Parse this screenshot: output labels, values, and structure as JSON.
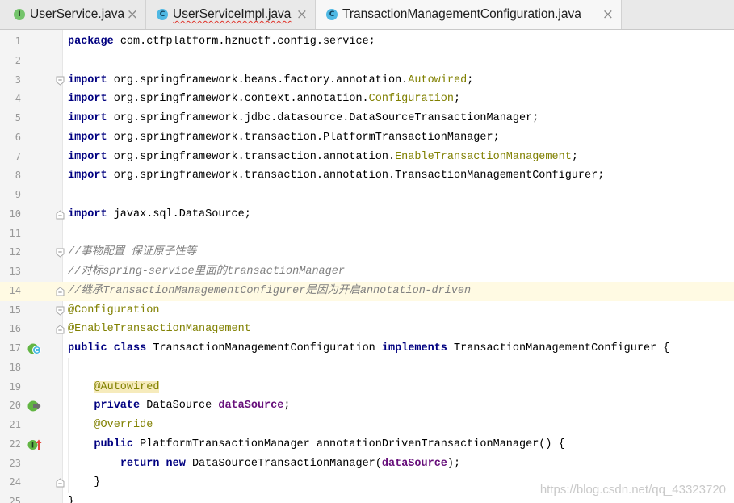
{
  "tabs": [
    {
      "label": "UserService.java",
      "icon": "interface-icon",
      "icon_letter": "I",
      "active": false,
      "has_error": false
    },
    {
      "label": "UserServiceImpl.java",
      "icon": "class-icon",
      "icon_letter": "C",
      "active": false,
      "has_error": true
    },
    {
      "label": "TransactionManagementConfiguration.java",
      "icon": "class-icon",
      "icon_letter": "C",
      "active": true,
      "has_error": false
    }
  ],
  "close_glyph": "×",
  "syntax_colors": {
    "default": "#000000",
    "keyword": "#000080",
    "annotation": "#808000",
    "comment": "#808080",
    "field": "#660e7a",
    "line_number": "#999999",
    "current_line_bg": "#fffae3",
    "warning_bg": "#f6ebbc"
  },
  "editor": {
    "current_line": 14,
    "lines": [
      {
        "n": "1",
        "tokens": [
          {
            "kind": "keyword",
            "text": "package"
          },
          {
            "kind": "plain",
            "text": " com.ctfplatform.hznuctf.config.service;"
          }
        ]
      },
      {
        "n": "2",
        "tokens": []
      },
      {
        "n": "3",
        "fold": "start",
        "tokens": [
          {
            "kind": "keyword",
            "text": "import"
          },
          {
            "kind": "plain",
            "text": " org.springframework.beans.factory.annotation."
          },
          {
            "kind": "annotation",
            "text": "Autowired"
          },
          {
            "kind": "plain",
            "text": ";"
          }
        ]
      },
      {
        "n": "4",
        "tokens": [
          {
            "kind": "keyword",
            "text": "import"
          },
          {
            "kind": "plain",
            "text": " org.springframework.context.annotation."
          },
          {
            "kind": "annotation",
            "text": "Configuration"
          },
          {
            "kind": "plain",
            "text": ";"
          }
        ]
      },
      {
        "n": "5",
        "tokens": [
          {
            "kind": "keyword",
            "text": "import"
          },
          {
            "kind": "plain",
            "text": " org.springframework.jdbc.datasource.DataSourceTransactionManager;"
          }
        ]
      },
      {
        "n": "6",
        "tokens": [
          {
            "kind": "keyword",
            "text": "import"
          },
          {
            "kind": "plain",
            "text": " org.springframework.transaction.PlatformTransactionManager;"
          }
        ]
      },
      {
        "n": "7",
        "tokens": [
          {
            "kind": "keyword",
            "text": "import"
          },
          {
            "kind": "plain",
            "text": " org.springframework.transaction.annotation."
          },
          {
            "kind": "annotation",
            "text": "EnableTransactionManagement"
          },
          {
            "kind": "plain",
            "text": ";"
          }
        ]
      },
      {
        "n": "8",
        "tokens": [
          {
            "kind": "keyword",
            "text": "import"
          },
          {
            "kind": "plain",
            "text": " org.springframework.transaction.annotation.TransactionManagementConfigurer;"
          }
        ]
      },
      {
        "n": "9",
        "tokens": []
      },
      {
        "n": "10",
        "fold": "end",
        "tokens": [
          {
            "kind": "keyword",
            "text": "import"
          },
          {
            "kind": "plain",
            "text": " javax.sql.DataSource;"
          }
        ]
      },
      {
        "n": "11",
        "tokens": []
      },
      {
        "n": "12",
        "fold": "start",
        "tokens": [
          {
            "kind": "comment",
            "text": "//事物配置 保证原子性等"
          }
        ]
      },
      {
        "n": "13",
        "tokens": [
          {
            "kind": "comment",
            "text": "//对标spring-service里面的transactionManager"
          }
        ]
      },
      {
        "n": "14",
        "fold": "end",
        "tokens": [
          {
            "kind": "comment",
            "text": "//继承TransactionManagementConfigurer是因为开启annotation",
            "caret_after": true
          },
          {
            "kind": "comment",
            "text": "-driven"
          }
        ]
      },
      {
        "n": "15",
        "fold": "start",
        "tokens": [
          {
            "kind": "annotation",
            "text": "@Configuration"
          }
        ]
      },
      {
        "n": "16",
        "fold": "end",
        "tokens": [
          {
            "kind": "annotation",
            "text": "@EnableTransactionManagement"
          }
        ]
      },
      {
        "n": "17",
        "gutter_icon": "implements-icon",
        "tokens": [
          {
            "kind": "keyword",
            "text": "public"
          },
          {
            "kind": "plain",
            "text": " "
          },
          {
            "kind": "keyword",
            "text": "class"
          },
          {
            "kind": "plain",
            "text": " TransactionManagementConfiguration "
          },
          {
            "kind": "keyword",
            "text": "implements"
          },
          {
            "kind": "plain",
            "text": " TransactionManagementConfigurer {"
          }
        ]
      },
      {
        "n": "18",
        "tokens": []
      },
      {
        "n": "19",
        "tokens": [
          {
            "kind": "plain",
            "text": "    "
          },
          {
            "kind": "warning-annotation",
            "text": "@Autowired"
          }
        ]
      },
      {
        "n": "20",
        "gutter_icon": "autowired-icon",
        "tokens": [
          {
            "kind": "plain",
            "text": "    "
          },
          {
            "kind": "keyword",
            "text": "private"
          },
          {
            "kind": "plain",
            "text": " DataSource "
          },
          {
            "kind": "field",
            "text": "dataSource"
          },
          {
            "kind": "plain",
            "text": ";"
          }
        ]
      },
      {
        "n": "21",
        "tokens": [
          {
            "kind": "plain",
            "text": "    "
          },
          {
            "kind": "annotation",
            "text": "@Override"
          }
        ]
      },
      {
        "n": "22",
        "gutter_icon": "override-icon",
        "tokens": [
          {
            "kind": "plain",
            "text": "    "
          },
          {
            "kind": "keyword",
            "text": "public"
          },
          {
            "kind": "plain",
            "text": " PlatformTransactionManager annotationDrivenTransactionManager() {"
          }
        ]
      },
      {
        "n": "23",
        "tokens": [
          {
            "kind": "plain",
            "text": "        "
          },
          {
            "kind": "keyword",
            "text": "return"
          },
          {
            "kind": "plain",
            "text": " "
          },
          {
            "kind": "keyword",
            "text": "new"
          },
          {
            "kind": "plain",
            "text": " DataSourceTransactionManager("
          },
          {
            "kind": "field",
            "text": "dataSource"
          },
          {
            "kind": "plain",
            "text": ");"
          }
        ]
      },
      {
        "n": "24",
        "fold": "end",
        "tokens": [
          {
            "kind": "plain",
            "text": "    }"
          }
        ]
      },
      {
        "n": "25",
        "tokens": [
          {
            "kind": "plain",
            "text": "}"
          }
        ]
      }
    ]
  },
  "watermark": "https://blog.csdn.net/qq_43323720"
}
